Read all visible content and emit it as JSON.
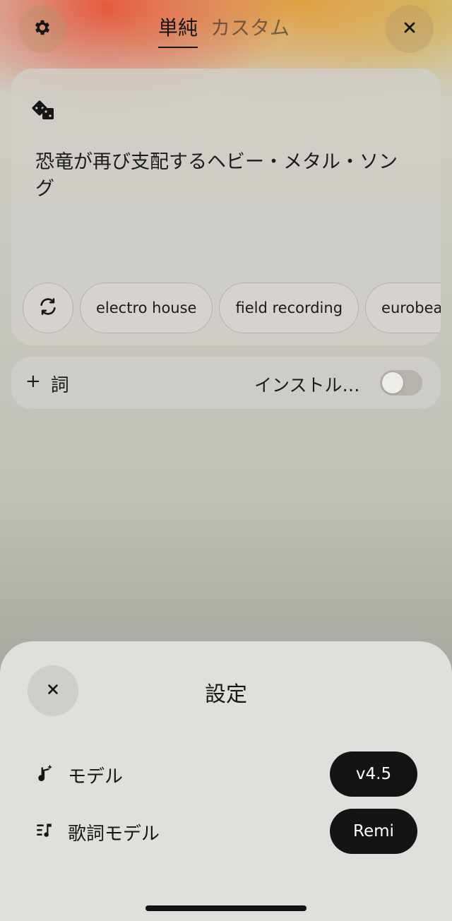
{
  "header": {
    "tabs": [
      {
        "label": "単純",
        "active": true
      },
      {
        "label": "カスタム",
        "active": false
      }
    ],
    "left_icon": "gear-icon",
    "right_icon": "close-icon"
  },
  "prompt_card": {
    "dice_icon": "dice-icon",
    "text": "恐竜が再び支配するヘビー・メタル・ソング",
    "refresh_icon": "refresh-icon",
    "chips": [
      "electro house",
      "field recording",
      "eurobeat"
    ]
  },
  "lyrics_bar": {
    "add_symbol": "+",
    "label": "詞",
    "instrumental_label": "インストル…",
    "instrumental_on": false
  },
  "settings_sheet": {
    "title": "設定",
    "close_icon": "close-icon",
    "rows": [
      {
        "icon": "music-sparkle-icon",
        "label": "モデル",
        "value": "v4.5"
      },
      {
        "icon": "lyrics-list-icon",
        "label": "歌詞モデル",
        "value": "Remi"
      }
    ]
  },
  "colors": {
    "pill_bg": "#141414",
    "sheet_bg": "#e0dfdb",
    "accent_warm": "#e84628"
  }
}
